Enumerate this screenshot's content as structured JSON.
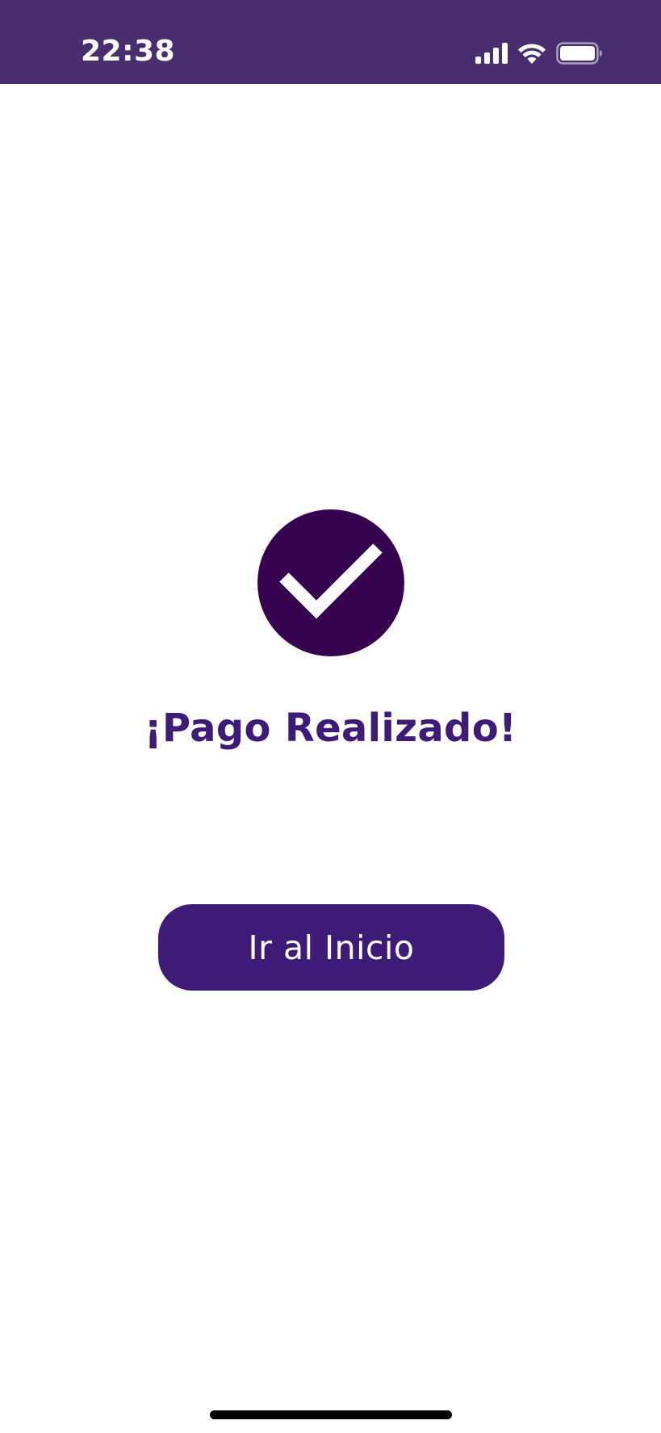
{
  "status_bar": {
    "time": "22:38",
    "icons": [
      "signal-icon",
      "wifi-icon",
      "battery-icon"
    ],
    "background": "#482d6f"
  },
  "main": {
    "icon": "checkmark-circle-icon",
    "title": "¡Pago Realizado!",
    "button_label": "Ir al Inicio"
  },
  "colors": {
    "accent": "#3f1b78",
    "icon_fill": "#36014f",
    "background": "#ffffff"
  }
}
